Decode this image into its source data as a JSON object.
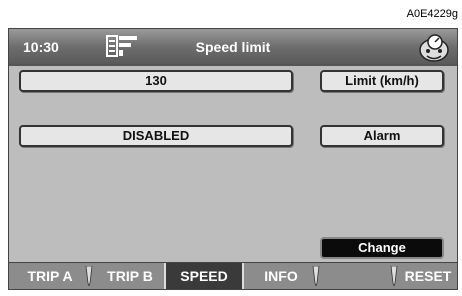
{
  "figure_code": "A0E4229g",
  "header": {
    "time": "10:30",
    "title": "Speed limit",
    "left_icon": "display-mode-icon",
    "right_icon": "speedometer-face-icon"
  },
  "rows": [
    {
      "value": "130",
      "label": "Limit (km/h)"
    },
    {
      "value": "DISABLED",
      "label": "Alarm"
    }
  ],
  "change_button": "Change",
  "tabs": [
    {
      "label": "TRIP A"
    },
    {
      "label": "TRIP B"
    },
    {
      "label": "SPEED",
      "active": true
    },
    {
      "label": "INFO"
    },
    {
      "label": ""
    },
    {
      "label": "RESET"
    }
  ],
  "colors": {
    "active_tab": "#3a3a3a",
    "change_button": "#0b0b0b"
  }
}
